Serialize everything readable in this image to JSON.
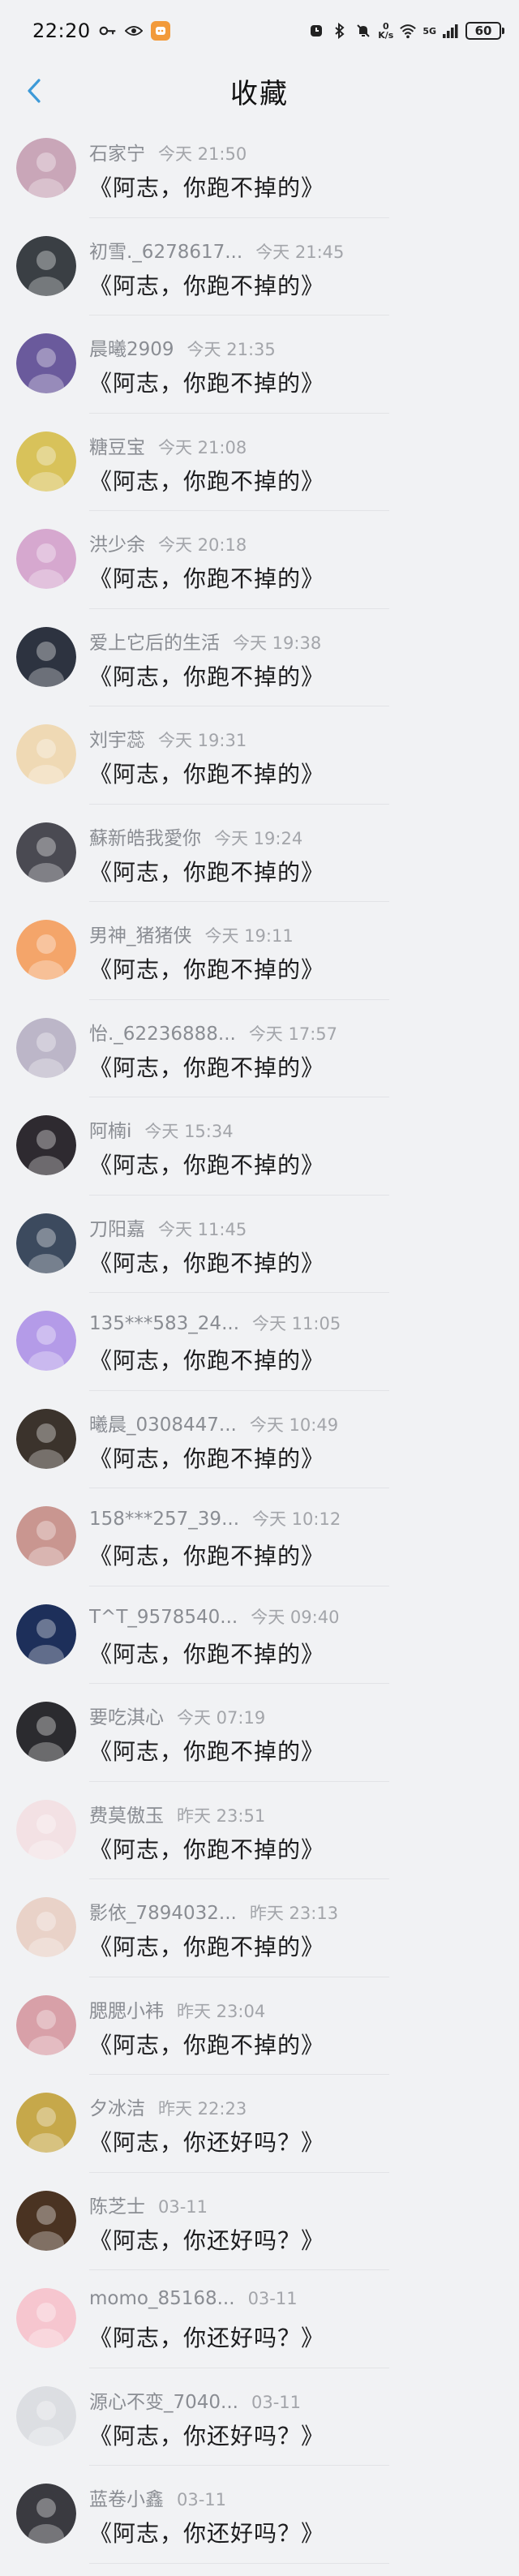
{
  "status_bar": {
    "time": "22:20",
    "network_speed_top": "0",
    "network_speed_bottom": "K/s",
    "network_type": "5G",
    "battery": "60"
  },
  "nav": {
    "title": "收藏"
  },
  "favorites": [
    {
      "user": "石家宁",
      "time": "今天 21:50",
      "title": "《阿志，你跑不掉的》",
      "avatar_color": "#c9a6b8"
    },
    {
      "user": "初雪._6278617...",
      "time": "今天 21:45",
      "title": "《阿志，你跑不掉的》",
      "avatar_color": "#3a3f44"
    },
    {
      "user": "晨曦2909",
      "time": "今天 21:35",
      "title": "《阿志，你跑不掉的》",
      "avatar_color": "#6a5a9c"
    },
    {
      "user": "糖豆宝",
      "time": "今天 21:08",
      "title": "《阿志，你跑不掉的》",
      "avatar_color": "#d8c25a"
    },
    {
      "user": "洪少余",
      "time": "今天 20:18",
      "title": "《阿志，你跑不掉的》",
      "avatar_color": "#d6a8cf"
    },
    {
      "user": "爱上它后的生活",
      "time": "今天 19:38",
      "title": "《阿志，你跑不掉的》",
      "avatar_color": "#2d3340"
    },
    {
      "user": "刘宇蕊",
      "time": "今天 19:31",
      "title": "《阿志，你跑不掉的》",
      "avatar_color": "#efd9b4"
    },
    {
      "user": "蘇新皓我愛你",
      "time": "今天 19:24",
      "title": "《阿志，你跑不掉的》",
      "avatar_color": "#4a4a52"
    },
    {
      "user": "男神_猪猪侠",
      "time": "今天 19:11",
      "title": "《阿志，你跑不掉的》",
      "avatar_color": "#f4a56a"
    },
    {
      "user": "怡._62236888...",
      "time": "今天 17:57",
      "title": "《阿志，你跑不掉的》",
      "avatar_color": "#bcb6c8"
    },
    {
      "user": "阿楠i",
      "time": "今天 15:34",
      "title": "《阿志，你跑不掉的》",
      "avatar_color": "#2e2a30"
    },
    {
      "user": "刀阳嘉",
      "time": "今天 11:45",
      "title": "《阿志，你跑不掉的》",
      "avatar_color": "#3c4a5e"
    },
    {
      "user": "135***583_24...",
      "time": "今天 11:05",
      "title": "《阿志，你跑不掉的》",
      "avatar_color": "#b49be8"
    },
    {
      "user": "曦晨_0308447...",
      "time": "今天 10:49",
      "title": "《阿志，你跑不掉的》",
      "avatar_color": "#3b332c"
    },
    {
      "user": "158***257_39...",
      "time": "今天 10:12",
      "title": "《阿志，你跑不掉的》",
      "avatar_color": "#c99690"
    },
    {
      "user": "T^T_9578540...",
      "time": "今天 09:40",
      "title": "《阿志，你跑不掉的》",
      "avatar_color": "#1d2f5a"
    },
    {
      "user": "要吃淇心",
      "time": "今天 07:19",
      "title": "《阿志，你跑不掉的》",
      "avatar_color": "#2b2b2f"
    },
    {
      "user": "费莫傲玉",
      "time": "昨天 23:51",
      "title": "《阿志，你跑不掉的》",
      "avatar_color": "#f3e1e4"
    },
    {
      "user": "影依_7894032...",
      "time": "昨天 23:13",
      "title": "《阿志，你跑不掉的》",
      "avatar_color": "#e9d2c8"
    },
    {
      "user": "腮腮小袆",
      "time": "昨天 23:04",
      "title": "《阿志，你跑不掉的》",
      "avatar_color": "#d8a0a8"
    },
    {
      "user": "夕冰洁",
      "time": "昨天 22:23",
      "title": "《阿志，你还好吗？》",
      "avatar_color": "#c6a84a"
    },
    {
      "user": "陈芝士",
      "time": "03-11",
      "title": "《阿志，你还好吗？》",
      "avatar_color": "#4a3322"
    },
    {
      "user": "momo_85168...",
      "time": "03-11",
      "title": "《阿志，你还好吗？》",
      "avatar_color": "#f6c6cf"
    },
    {
      "user": "源心不变_7040...",
      "time": "03-11",
      "title": "《阿志，你还好吗？》",
      "avatar_color": "#dcdee2"
    },
    {
      "user": "蓝卷小鑫",
      "time": "03-11",
      "title": "《阿志，你还好吗？》",
      "avatar_color": "#3a3a40"
    }
  ]
}
